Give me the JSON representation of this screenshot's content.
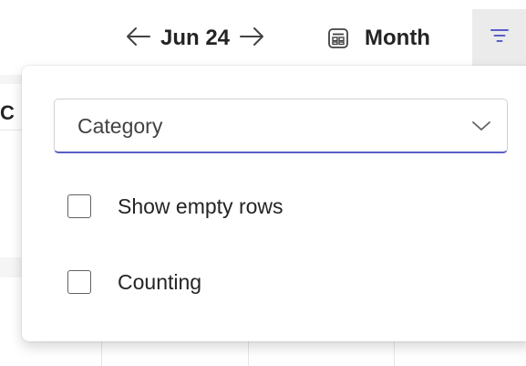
{
  "toolbar": {
    "prev_icon": "arrow-left-icon",
    "date_label": "Jun 24",
    "next_icon": "arrow-right-icon",
    "view_icon": "calendar-view-icon",
    "view_label": "Month",
    "filter_icon": "filter-icon"
  },
  "background": {
    "fragment_text": "C"
  },
  "filter_panel": {
    "group_by": {
      "selected_value": "Category",
      "chevron_icon": "chevron-down-icon"
    },
    "options": [
      {
        "label": "Show empty rows",
        "checked": false
      },
      {
        "label": "Counting",
        "checked": false
      }
    ]
  },
  "colors": {
    "accent": "#5b5fc7",
    "text": "#242424",
    "filter_button_bg": "#ebebeb"
  }
}
